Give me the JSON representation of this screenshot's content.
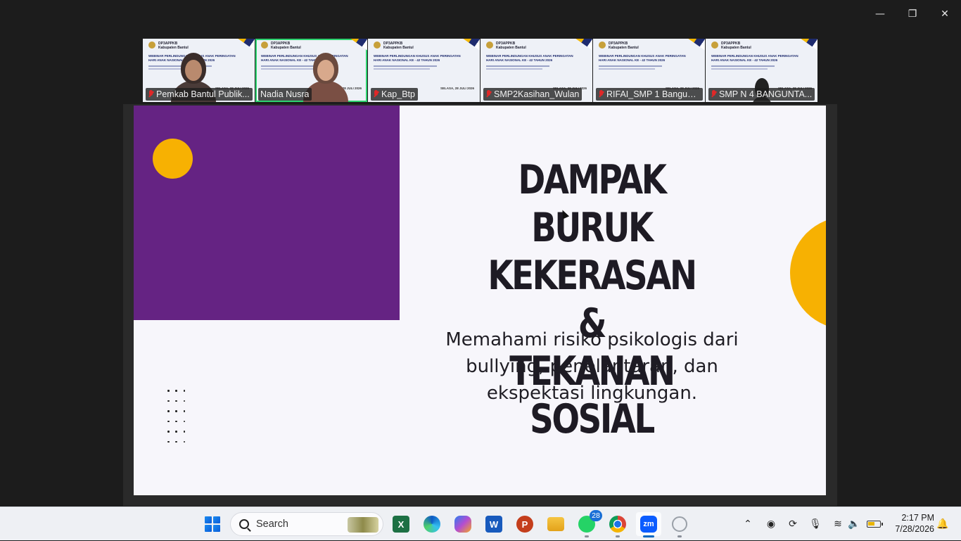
{
  "window_controls": {
    "minimize": "—",
    "restore": "❐",
    "close": "✕"
  },
  "participants": [
    {
      "name": "Pemkab Bantul Publik...",
      "muted": true,
      "active": false,
      "has_video": true
    },
    {
      "name": "Nadia Nusra",
      "muted": false,
      "active": true,
      "has_video": true
    },
    {
      "name": "Kap_Btp",
      "muted": true,
      "active": false,
      "has_video": false
    },
    {
      "name": "SMP2Kasihan_Wulan",
      "muted": true,
      "active": false,
      "has_video": false
    },
    {
      "name": "RIFAI_SMP 1 Banguntan...",
      "muted": true,
      "active": false,
      "has_video": false
    },
    {
      "name": "SMP N 4 BANGUNTA...",
      "muted": true,
      "active": false,
      "has_video": true
    }
  ],
  "thumbnail_slide": {
    "org": "DP3APPKB",
    "org_sub": "Kabupaten Bantul",
    "title": "WEBINAR PERLINDUNGAN KHUSUS ANAK PERINGATAN HARI ANAK NASIONAL KE - 42 TAHUN 2026",
    "date": "SELASA, 28 JULI 2026"
  },
  "slide": {
    "title_lines": [
      "DAMPAK BURUK",
      "KEKERASAN &",
      "TEKANAN SOSIAL"
    ],
    "subtitle_lines": [
      "Memahami risiko psikologis dari",
      "bullying, penelantaran, dan",
      "ekspektasi lingkungan."
    ],
    "colors": {
      "purple": "#652383",
      "yellow": "#f7b102",
      "background": "#f7f6fb"
    }
  },
  "taskbar": {
    "search_label": "Search",
    "apps": [
      {
        "name": "start",
        "icon": "windows-logo"
      },
      {
        "name": "excel",
        "icon": "excel-icon",
        "glyph": "X"
      },
      {
        "name": "edge",
        "icon": "edge-icon"
      },
      {
        "name": "copilot",
        "icon": "copilot-icon"
      },
      {
        "name": "word",
        "icon": "word-icon",
        "glyph": "W"
      },
      {
        "name": "powerpoint",
        "icon": "powerpoint-icon",
        "glyph": "P"
      },
      {
        "name": "file-explorer",
        "icon": "folder-icon"
      },
      {
        "name": "whatsapp",
        "icon": "whatsapp-icon",
        "badge": "28"
      },
      {
        "name": "chrome",
        "icon": "chrome-icon"
      },
      {
        "name": "zoom",
        "icon": "zoom-icon",
        "glyph": "zm"
      },
      {
        "name": "other",
        "icon": "app-icon"
      }
    ],
    "time": "2:17 PM",
    "date": "7/28/2026"
  }
}
